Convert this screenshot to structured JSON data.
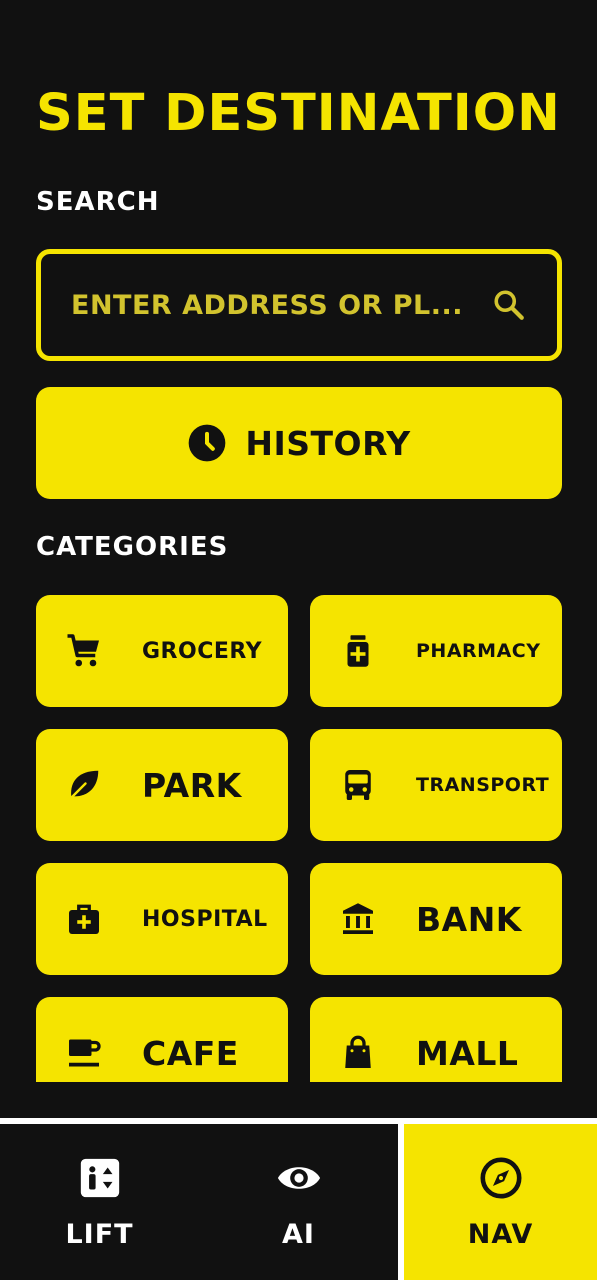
{
  "page": {
    "title": "SET DESTINATION"
  },
  "search": {
    "section_label": "SEARCH",
    "placeholder": "ENTER ADDRESS OR PL...",
    "icon": "search-icon"
  },
  "history": {
    "label": "HISTORY",
    "icon": "clock-icon"
  },
  "categories": {
    "section_label": "CATEGORIES",
    "items": [
      {
        "label": "GROCERY",
        "icon": "cart-icon"
      },
      {
        "label": "PHARMACY",
        "icon": "medicine-icon"
      },
      {
        "label": "PARK",
        "icon": "leaf-icon"
      },
      {
        "label": "TRANSPORT",
        "icon": "bus-icon"
      },
      {
        "label": "HOSPITAL",
        "icon": "medical-bag-icon"
      },
      {
        "label": "BANK",
        "icon": "bank-icon"
      },
      {
        "label": "CAFE",
        "icon": "coffee-icon"
      },
      {
        "label": "MALL",
        "icon": "shopping-bag-icon"
      }
    ]
  },
  "bottom_nav": {
    "items": [
      {
        "label": "LIFT",
        "icon": "elevator-icon",
        "active": false
      },
      {
        "label": "AI",
        "icon": "eye-icon",
        "active": false
      },
      {
        "label": "NAV",
        "icon": "compass-icon",
        "active": true
      }
    ]
  },
  "colors": {
    "accent": "#F5E400",
    "background": "#111111",
    "text_light": "#FFFFFF",
    "text_dark": "#111111"
  }
}
